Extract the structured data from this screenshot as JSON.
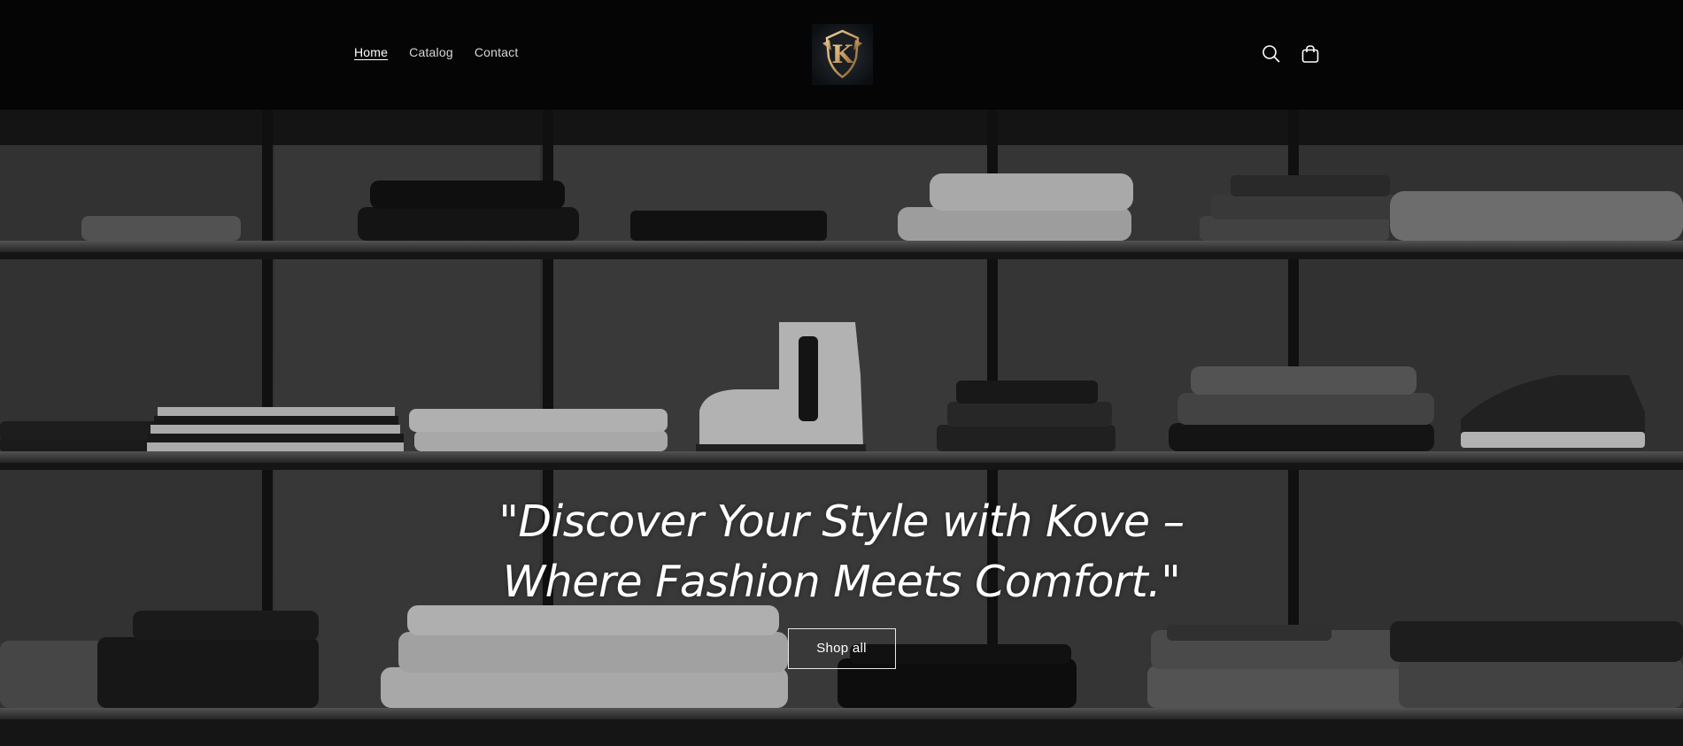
{
  "header": {
    "nav": [
      {
        "label": "Home",
        "active": true
      },
      {
        "label": "Catalog",
        "active": false
      },
      {
        "label": "Contact",
        "active": false
      }
    ],
    "logo_icon": "kove-shield-logo",
    "icons": [
      "search-icon",
      "cart-icon"
    ]
  },
  "hero": {
    "heading": "\"Discover Your Style with Kove – Where Fashion Meets Comfort.\"",
    "button_label": "Shop all",
    "background": "monochrome clothing shelves"
  },
  "colors": {
    "header_bg": "#050505",
    "text": "#ffffff",
    "nav_text": "#d7d7d7",
    "logo_gold": "#c9a064"
  }
}
